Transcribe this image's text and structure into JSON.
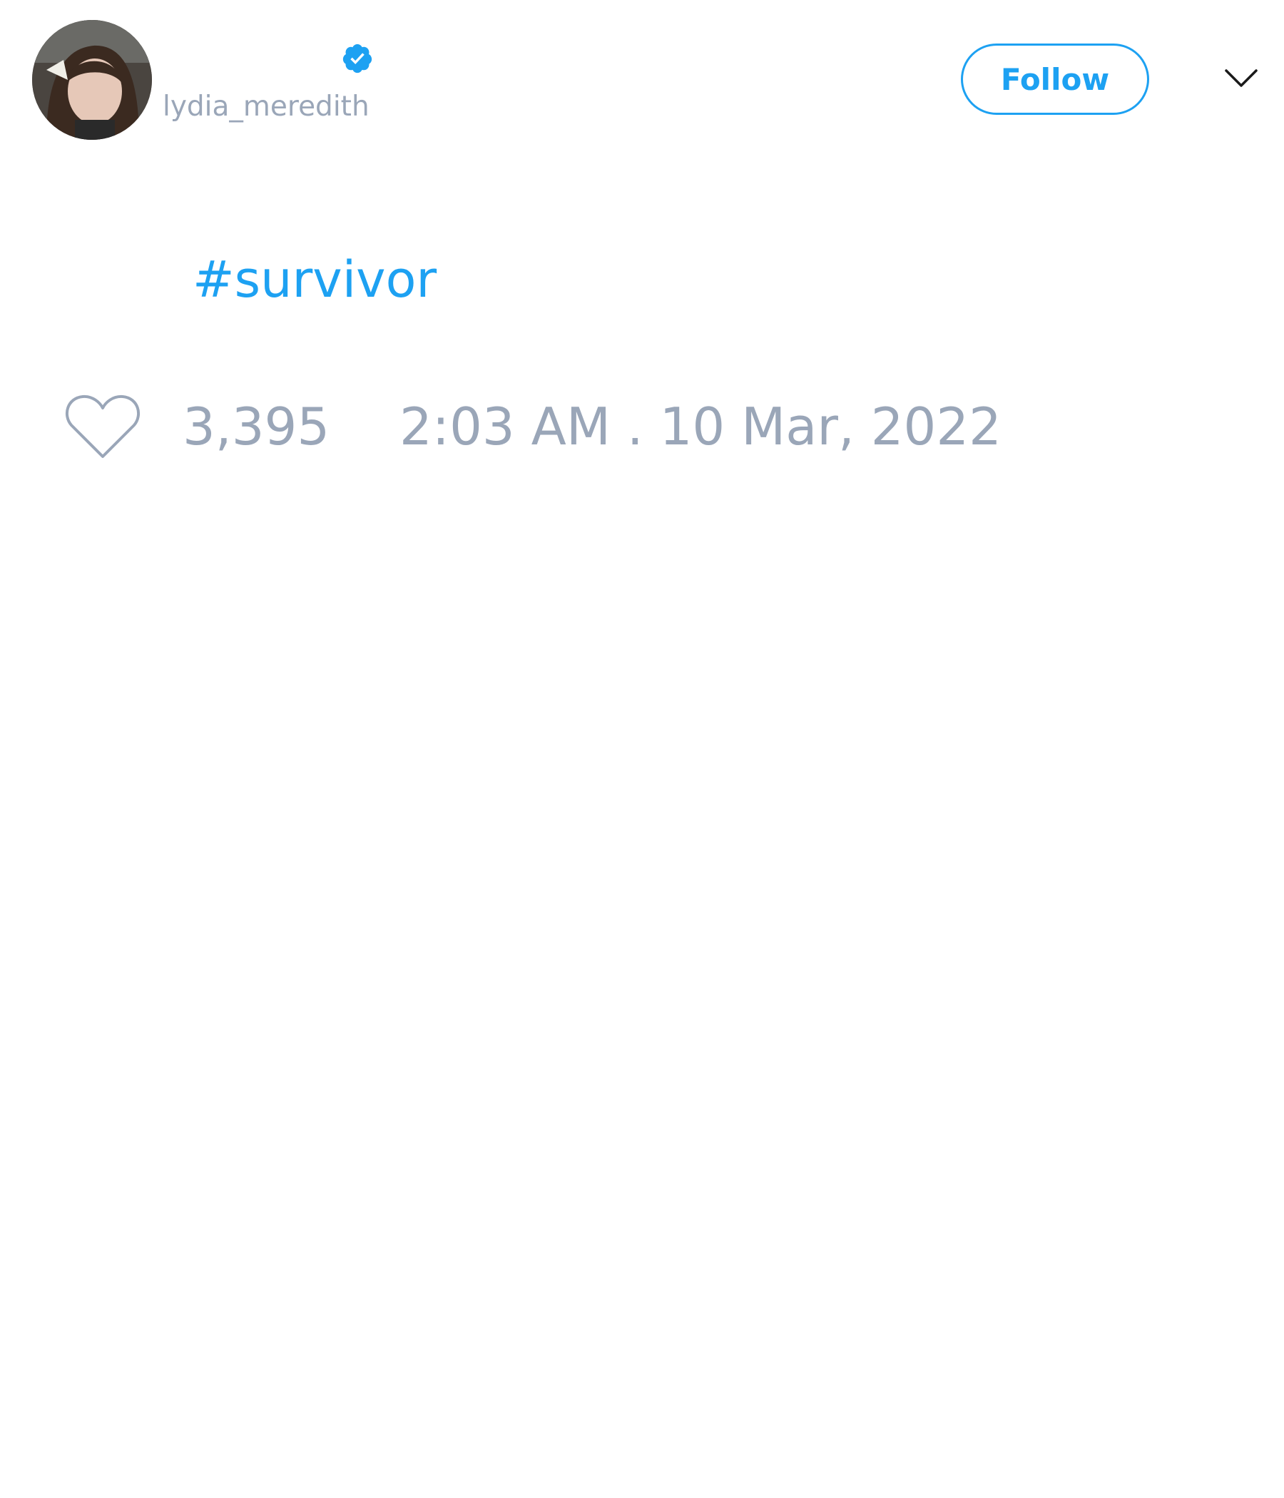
{
  "header": {
    "handle": "lydia_meredith",
    "verified": true,
    "follow_label": "Follow"
  },
  "tweet": {
    "text": "#survivor"
  },
  "footer": {
    "like_count": "3,395",
    "timestamp": "2:03 AM . 10 Mar, 2022"
  },
  "icons": {
    "verified": "verified-badge-icon",
    "menu": "chevron-down-icon",
    "like": "heart-icon"
  },
  "colors": {
    "accent": "#1da1f2",
    "muted": "#9aa6b8"
  }
}
